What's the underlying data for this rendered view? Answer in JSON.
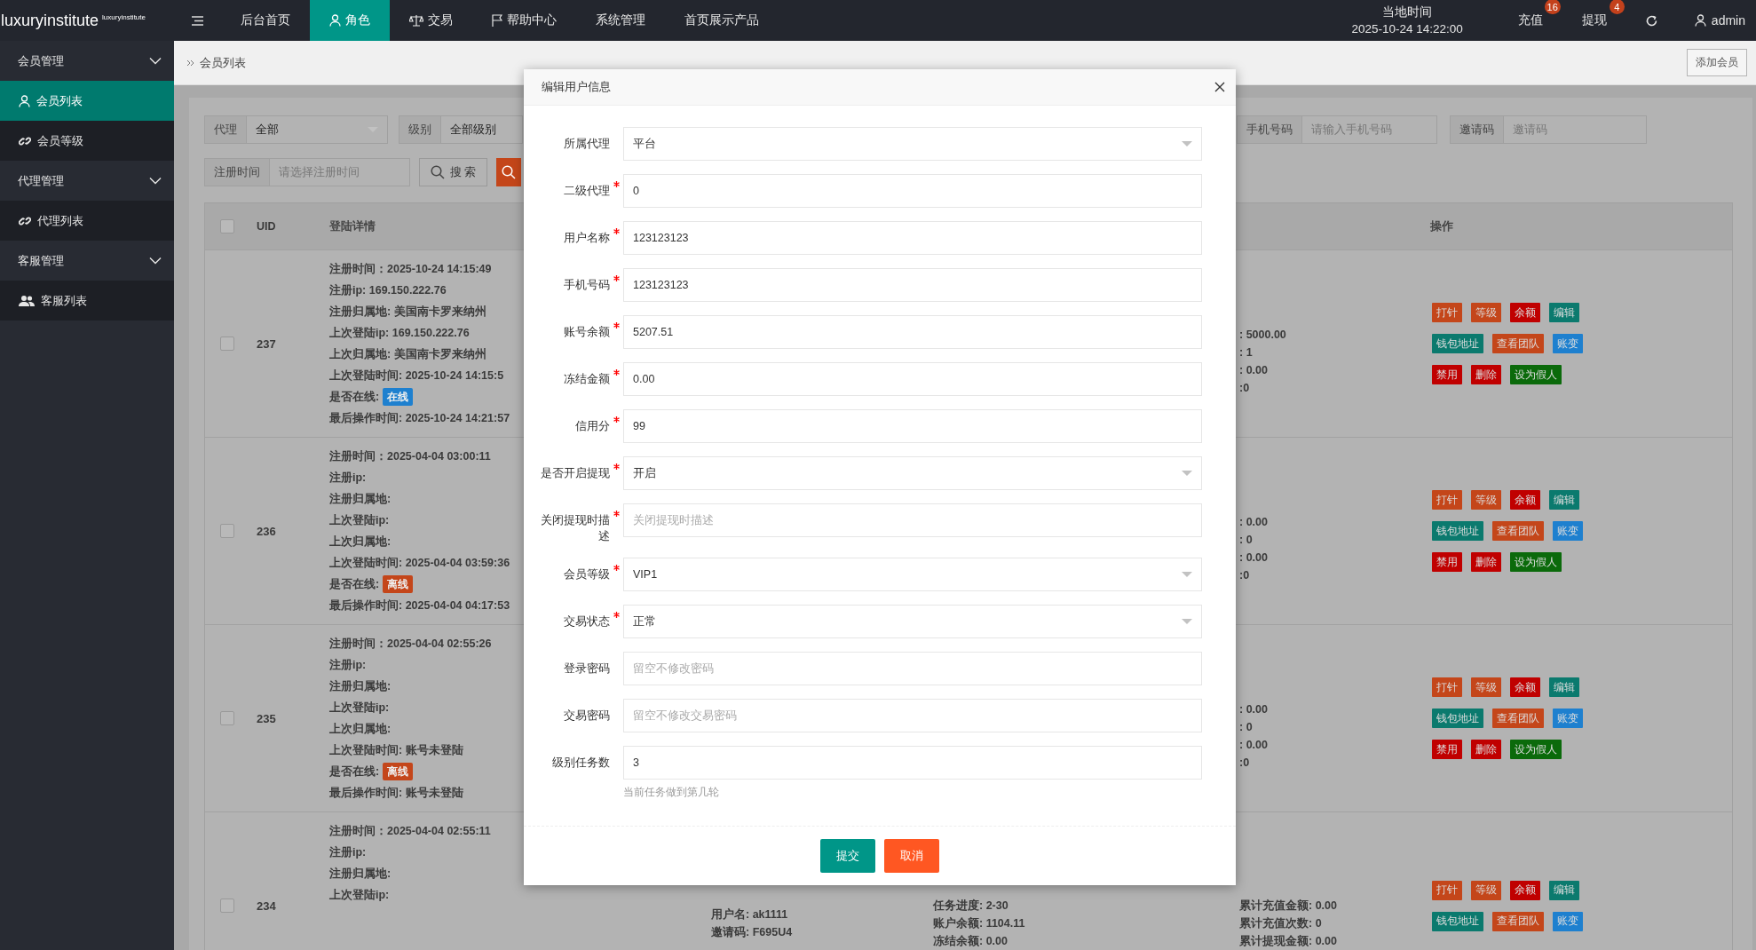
{
  "header": {
    "logo": "luxuryinstitute",
    "logo_sup": "luxuryinstitute",
    "nav": [
      {
        "label": "后台首页",
        "selected": false
      },
      {
        "label": "角色",
        "selected": true
      },
      {
        "label": "交易",
        "selected": false
      },
      {
        "label": "帮助中心",
        "selected": false
      },
      {
        "label": "系统管理",
        "selected": false
      },
      {
        "label": "首页展示产品",
        "selected": false
      }
    ],
    "clock_label": "当地时间",
    "clock_time": "2025-10-24 14:22:00",
    "links": [
      {
        "label": "充值",
        "badge": "16"
      },
      {
        "label": "提现",
        "badge": "4"
      }
    ],
    "user": "admin"
  },
  "sidebar": [
    {
      "label": "会员管理",
      "expanded": true,
      "children": [
        {
          "label": "会员列表",
          "selected": true
        },
        {
          "label": "会员等级",
          "selected": false
        }
      ]
    },
    {
      "label": "代理管理",
      "expanded": true,
      "children": [
        {
          "label": "代理列表",
          "selected": false
        }
      ]
    },
    {
      "label": "客服管理",
      "expanded": true,
      "children": [
        {
          "label": "客服列表",
          "selected": false
        }
      ]
    }
  ],
  "breadcrumb": {
    "current": "会员列表",
    "add_button": "添加会员"
  },
  "filter_rows": [
    [
      {
        "label": "代理",
        "kind": "select",
        "value": "全部"
      },
      {
        "label": "级别",
        "kind": "input",
        "value": "全部级别"
      },
      {
        "label": "手机号码",
        "kind": "input",
        "placeholder": "请输入手机号码"
      },
      {
        "label": "邀请码",
        "kind": "input",
        "placeholder": "邀请码"
      }
    ],
    [
      {
        "label": "注册时间",
        "kind": "input",
        "placeholder": "请选择注册时间"
      }
    ]
  ],
  "search_button": "搜 索",
  "table": {
    "all_checked": false,
    "columns": [
      "UID",
      "登陆详情",
      "操作"
    ],
    "rows": [
      {
        "checked": false,
        "uid": "237",
        "details": [
          {
            "text": "注册时间：2025-10-24 14:15:49"
          },
          {
            "text": "注册ip: 169.150.222.76"
          },
          {
            "text": "注册归属地: 美国南卡罗来纳州"
          },
          {
            "text": "上次登陆ip: 169.150.222.76"
          },
          {
            "text": "上次归属地: 美国南卡罗来纳州"
          },
          {
            "text": "上次登陆时间: 2025-10-24 14:15:5"
          },
          {
            "text": "是否在线:",
            "status": "在线",
            "online": true
          },
          {
            "text": "最后操作时间: 2025-10-24 14:21:57"
          }
        ],
        "column_5": [
          ": 5000.00",
          ": 1",
          ": 0.00",
          ":0"
        ],
        "actions": [
          [
            {
              "label": "打针",
              "color": "#c4461a"
            },
            {
              "label": "等级",
              "color": "#c4461a"
            },
            {
              "label": "余额",
              "color": "#c00000"
            },
            {
              "label": "编辑",
              "color": "#0b7a6e"
            }
          ],
          [
            {
              "label": "钱包地址",
              "color": "#0b7a6e"
            },
            {
              "label": "查看团队",
              "color": "#c4461a"
            },
            {
              "label": "账变",
              "color": "#1e80cf"
            }
          ],
          [
            {
              "label": "禁用",
              "color": "#c00000"
            },
            {
              "label": "删除",
              "color": "#c00000"
            },
            {
              "label": "设为假人",
              "color": "#0b6a0b"
            }
          ]
        ]
      },
      {
        "checked": false,
        "uid": "236",
        "details": [
          {
            "text": "注册时间：2025-04-04 03:00:11"
          },
          {
            "text": "注册ip:"
          },
          {
            "text": "注册归属地:"
          },
          {
            "text": "上次登陆ip:"
          },
          {
            "text": "上次归属地:"
          },
          {
            "text": "上次登陆时间: 2025-04-04 03:59:36"
          },
          {
            "text": "是否在线:",
            "status": "离线",
            "online": false
          },
          {
            "text": "最后操作时间: 2025-04-04 04:17:53"
          }
        ],
        "column_5": [
          ": 0.00",
          ": 0",
          ": 0.00",
          ":0"
        ],
        "actions": [
          [
            {
              "label": "打针",
              "color": "#c4461a"
            },
            {
              "label": "等级",
              "color": "#c4461a"
            },
            {
              "label": "余额",
              "color": "#c00000"
            },
            {
              "label": "编辑",
              "color": "#0b7a6e"
            }
          ],
          [
            {
              "label": "钱包地址",
              "color": "#0b7a6e"
            },
            {
              "label": "查看团队",
              "color": "#c4461a"
            },
            {
              "label": "账变",
              "color": "#1e80cf"
            }
          ],
          [
            {
              "label": "禁用",
              "color": "#c00000"
            },
            {
              "label": "删除",
              "color": "#c00000"
            },
            {
              "label": "设为假人",
              "color": "#0b6a0b"
            }
          ]
        ]
      },
      {
        "checked": false,
        "uid": "235",
        "details": [
          {
            "text": "注册时间：2025-04-04 02:55:26"
          },
          {
            "text": "注册ip:"
          },
          {
            "text": "注册归属地:"
          },
          {
            "text": "上次登陆ip:"
          },
          {
            "text": "上次归属地:"
          },
          {
            "text": "上次登陆时间: 账号未登陆"
          },
          {
            "text": "是否在线:",
            "status": "离线",
            "online": false
          },
          {
            "text": "最后操作时间: 账号未登陆"
          }
        ],
        "column_5": [
          ": 0.00",
          ": 0",
          ": 0.00",
          ":0"
        ],
        "actions": [
          [
            {
              "label": "打针",
              "color": "#c4461a"
            },
            {
              "label": "等级",
              "color": "#c4461a"
            },
            {
              "label": "余额",
              "color": "#c00000"
            },
            {
              "label": "编辑",
              "color": "#0b7a6e"
            }
          ],
          [
            {
              "label": "钱包地址",
              "color": "#0b7a6e"
            },
            {
              "label": "查看团队",
              "color": "#c4461a"
            },
            {
              "label": "账变",
              "color": "#1e80cf"
            }
          ],
          [
            {
              "label": "禁用",
              "color": "#c00000"
            },
            {
              "label": "删除",
              "color": "#c00000"
            },
            {
              "label": "设为假人",
              "color": "#0b6a0b"
            }
          ]
        ]
      },
      {
        "checked": false,
        "uid": "234",
        "details": [
          {
            "text": "注册时间：2025-04-04 02:55:11"
          },
          {
            "text": "注册ip:"
          },
          {
            "text": "注册归属地:"
          },
          {
            "text": "上次登陆ip:"
          }
        ],
        "column_3": [
          "用户名: ak1111",
          "邀请码: F695U4"
        ],
        "column_4": [
          "任务进度: 2-30",
          "账户余额: 1104.11",
          "冻结余额: 0.00"
        ],
        "column_5": [
          "累计充值金额: 0.00",
          "累计充值次数: 0",
          "累计提现金额: 0.00"
        ],
        "actions": [
          [
            {
              "label": "打针",
              "color": "#c4461a"
            },
            {
              "label": "等级",
              "color": "#c4461a"
            },
            {
              "label": "余额",
              "color": "#c00000"
            },
            {
              "label": "编辑",
              "color": "#0b7a6e"
            }
          ],
          [
            {
              "label": "钱包地址",
              "color": "#0b7a6e"
            },
            {
              "label": "查看团队",
              "color": "#c4461a"
            },
            {
              "label": "账变",
              "color": "#1e80cf"
            }
          ]
        ]
      }
    ]
  },
  "modal": {
    "title": "编辑用户信息",
    "fields": [
      {
        "label": "所属代理",
        "required": false,
        "kind": "select",
        "value": "平台"
      },
      {
        "label": "二级代理",
        "required": true,
        "kind": "input",
        "value": "0"
      },
      {
        "label": "用户名称",
        "required": true,
        "kind": "input",
        "value": "123123123"
      },
      {
        "label": "手机号码",
        "required": true,
        "kind": "input",
        "value": "123123123"
      },
      {
        "label": "账号余额",
        "required": true,
        "kind": "input",
        "value": "5207.51"
      },
      {
        "label": "冻结金额",
        "required": true,
        "kind": "input",
        "value": "0.00"
      },
      {
        "label": "信用分",
        "required": true,
        "kind": "input",
        "value": "99"
      },
      {
        "label": "是否开启提现",
        "required": true,
        "kind": "select",
        "value": "开启"
      },
      {
        "label": "关闭提现时描述",
        "required": true,
        "kind": "input",
        "placeholder": "关闭提现时描述"
      },
      {
        "label": "会员等级",
        "required": true,
        "kind": "select",
        "value": "VIP1"
      },
      {
        "label": "交易状态",
        "required": true,
        "kind": "select",
        "value": "正常"
      },
      {
        "label": "登录密码",
        "required": false,
        "kind": "input",
        "placeholder": "留空不修改密码"
      },
      {
        "label": "交易密码",
        "required": false,
        "kind": "input",
        "placeholder": "留空不修改交易密码"
      },
      {
        "label": "级别任务数",
        "required": false,
        "kind": "input",
        "value": "3",
        "hint": "当前任务做到第几轮"
      }
    ],
    "buttons": [
      {
        "label": "提交",
        "kind": "primary"
      },
      {
        "label": "取消",
        "kind": "cancel"
      }
    ]
  }
}
